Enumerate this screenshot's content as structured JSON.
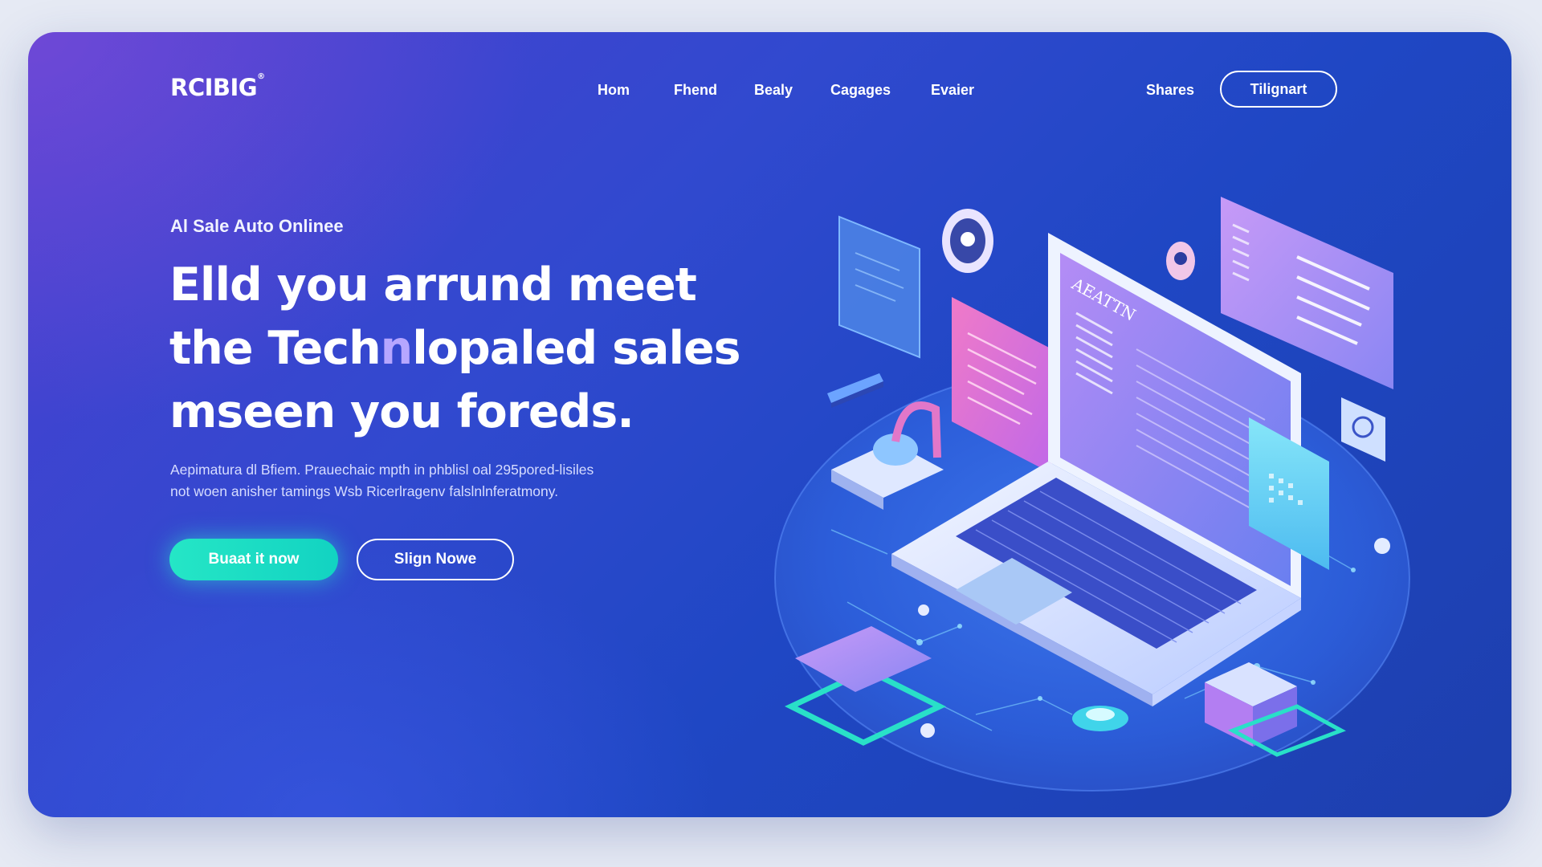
{
  "brand": {
    "logo_text": "RCIBIG",
    "logo_mark": "®"
  },
  "nav": {
    "links": [
      "Hom",
      "Fhend",
      "Bealy",
      "Cagages",
      "Evaier"
    ],
    "shares_label": "Shares",
    "cta_label": "Tilignart"
  },
  "hero": {
    "eyebrow": "Al Sale Auto Onlinee",
    "headline_line1": "Elld you arrund meet",
    "headline_line2_a": "the Tech",
    "headline_line2_hl": "n",
    "headline_line2_b": "lopaled sales",
    "headline_line3": "mseen you foreds.",
    "subtext_line1": "Aepimatura dl Bfiem. Prauechaic mpth in phblisl oal 295pored-lisiles",
    "subtext_line2": "not woen anisher tamings Wsb Ricerlragenv falslnlnferatmony.",
    "primary_button": "Buaat it now",
    "secondary_button": "Slign Nowe"
  },
  "illustration": {
    "screen_heading": "AEATTN",
    "icons": [
      "laptop-icon",
      "headset-icon",
      "location-pin-icon",
      "chat-bubble-icon",
      "document-icon",
      "chart-card-icon",
      "server-cube-icon",
      "tablet-card-icon",
      "robot-arm-icon"
    ]
  },
  "colors": {
    "background_start": "#4b3fd0",
    "background_end": "#1d3fae",
    "accent_teal": "#25e6c6",
    "accent_pink": "#e86ac9",
    "accent_violet": "#b6a6ff"
  }
}
